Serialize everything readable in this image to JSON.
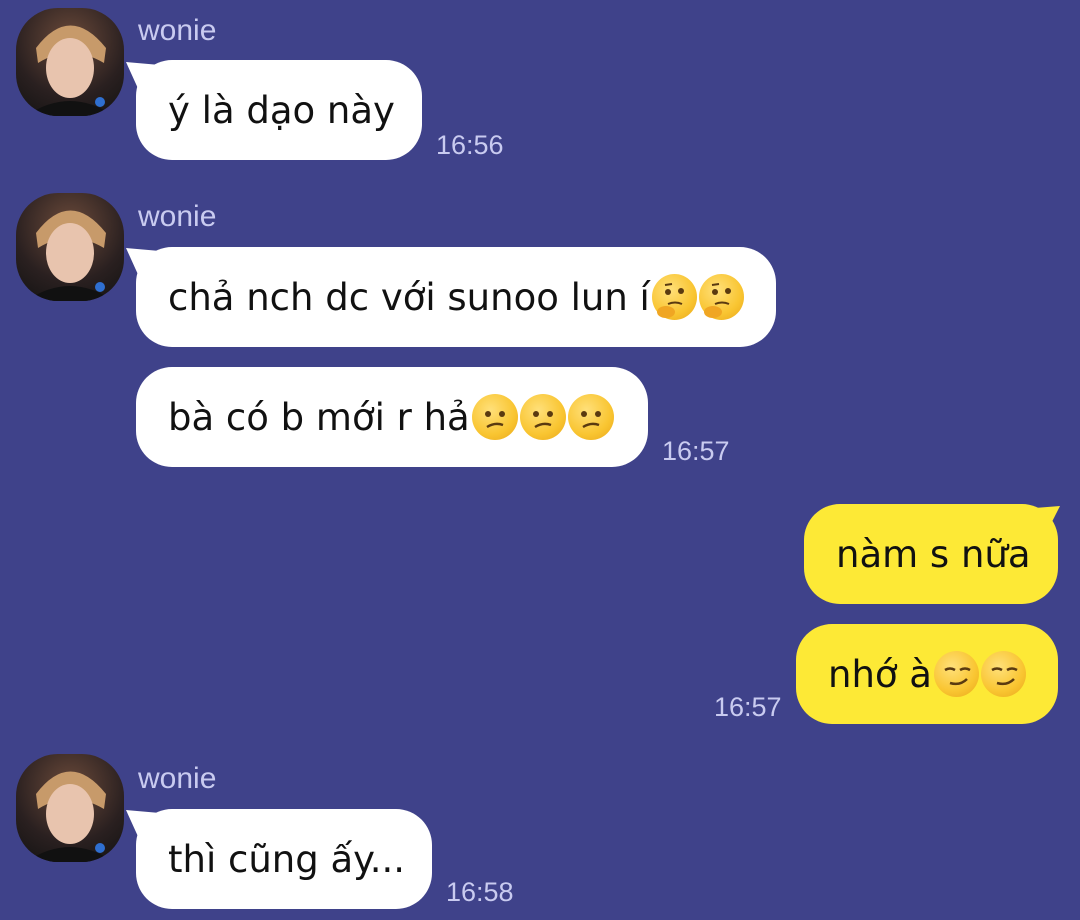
{
  "chat": {
    "contact_name": "wonie",
    "messages": [
      {
        "side": "in",
        "text": "ý là dạo này",
        "emojis": [],
        "time": "16:56"
      },
      {
        "side": "in",
        "text": "chả nch dc với sunoo lun í",
        "emojis": [
          "thinking-face",
          "thinking-face"
        ]
      },
      {
        "side": "in",
        "text": "bà có b mới r hả",
        "emojis": [
          "confused-face",
          "confused-face",
          "confused-face"
        ],
        "time": "16:57"
      },
      {
        "side": "out",
        "text": "nàm s nữa",
        "emojis": []
      },
      {
        "side": "out",
        "text": "nhớ à",
        "emojis": [
          "smirking-face",
          "smirking-face"
        ],
        "time": "16:57"
      },
      {
        "side": "in",
        "text": "thì cũng ấy...",
        "emojis": [],
        "time": "16:58"
      }
    ]
  },
  "colors": {
    "background": "#3f428a",
    "incoming_bubble": "#ffffff",
    "outgoing_bubble": "#fde936",
    "meta_text": "#c9cbf0"
  }
}
